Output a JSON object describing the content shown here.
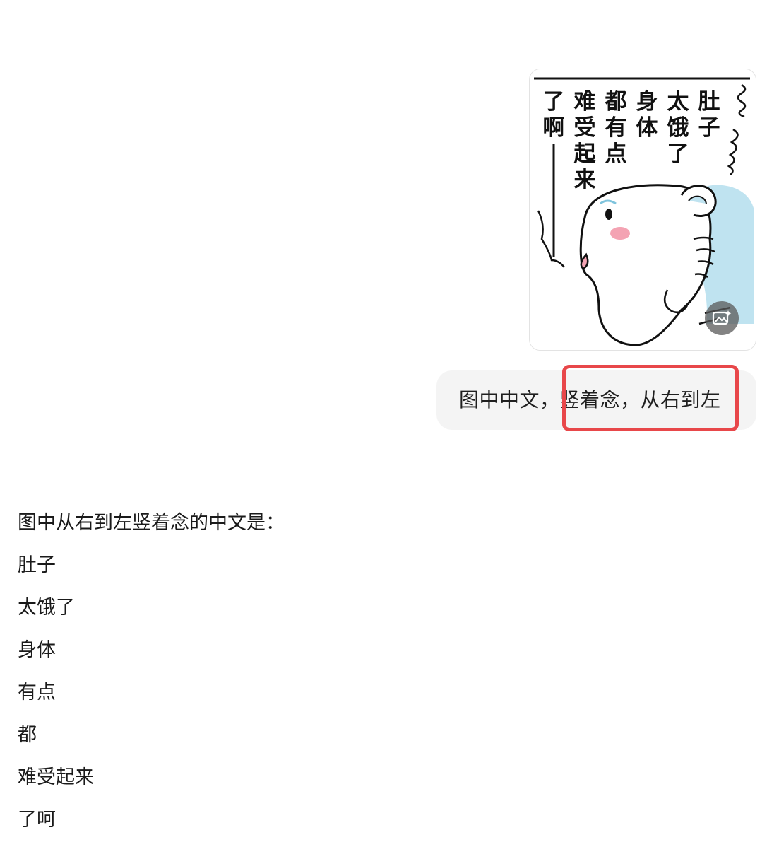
{
  "user_image": {
    "vertical_text_columns": [
      "肚子",
      "太饿了",
      "身体",
      "都有点",
      "难受起来",
      "了啊"
    ],
    "ai_edit_icon": "image-sparkle-icon"
  },
  "user_message": {
    "text": "图中中文，竖着念，从右到左",
    "highlight_color": "#e8474a"
  },
  "assistant_reply": {
    "intro": "图中从右到左竖着念的中文是：",
    "lines": [
      "肚子",
      "太饿了",
      "身体",
      "有点",
      "都",
      "难受起来",
      "了呵"
    ]
  },
  "colors": {
    "bubble_bg": "#f4f4f4",
    "hamster_blue": "#bfe3f0",
    "blush": "#f4a3b3"
  }
}
